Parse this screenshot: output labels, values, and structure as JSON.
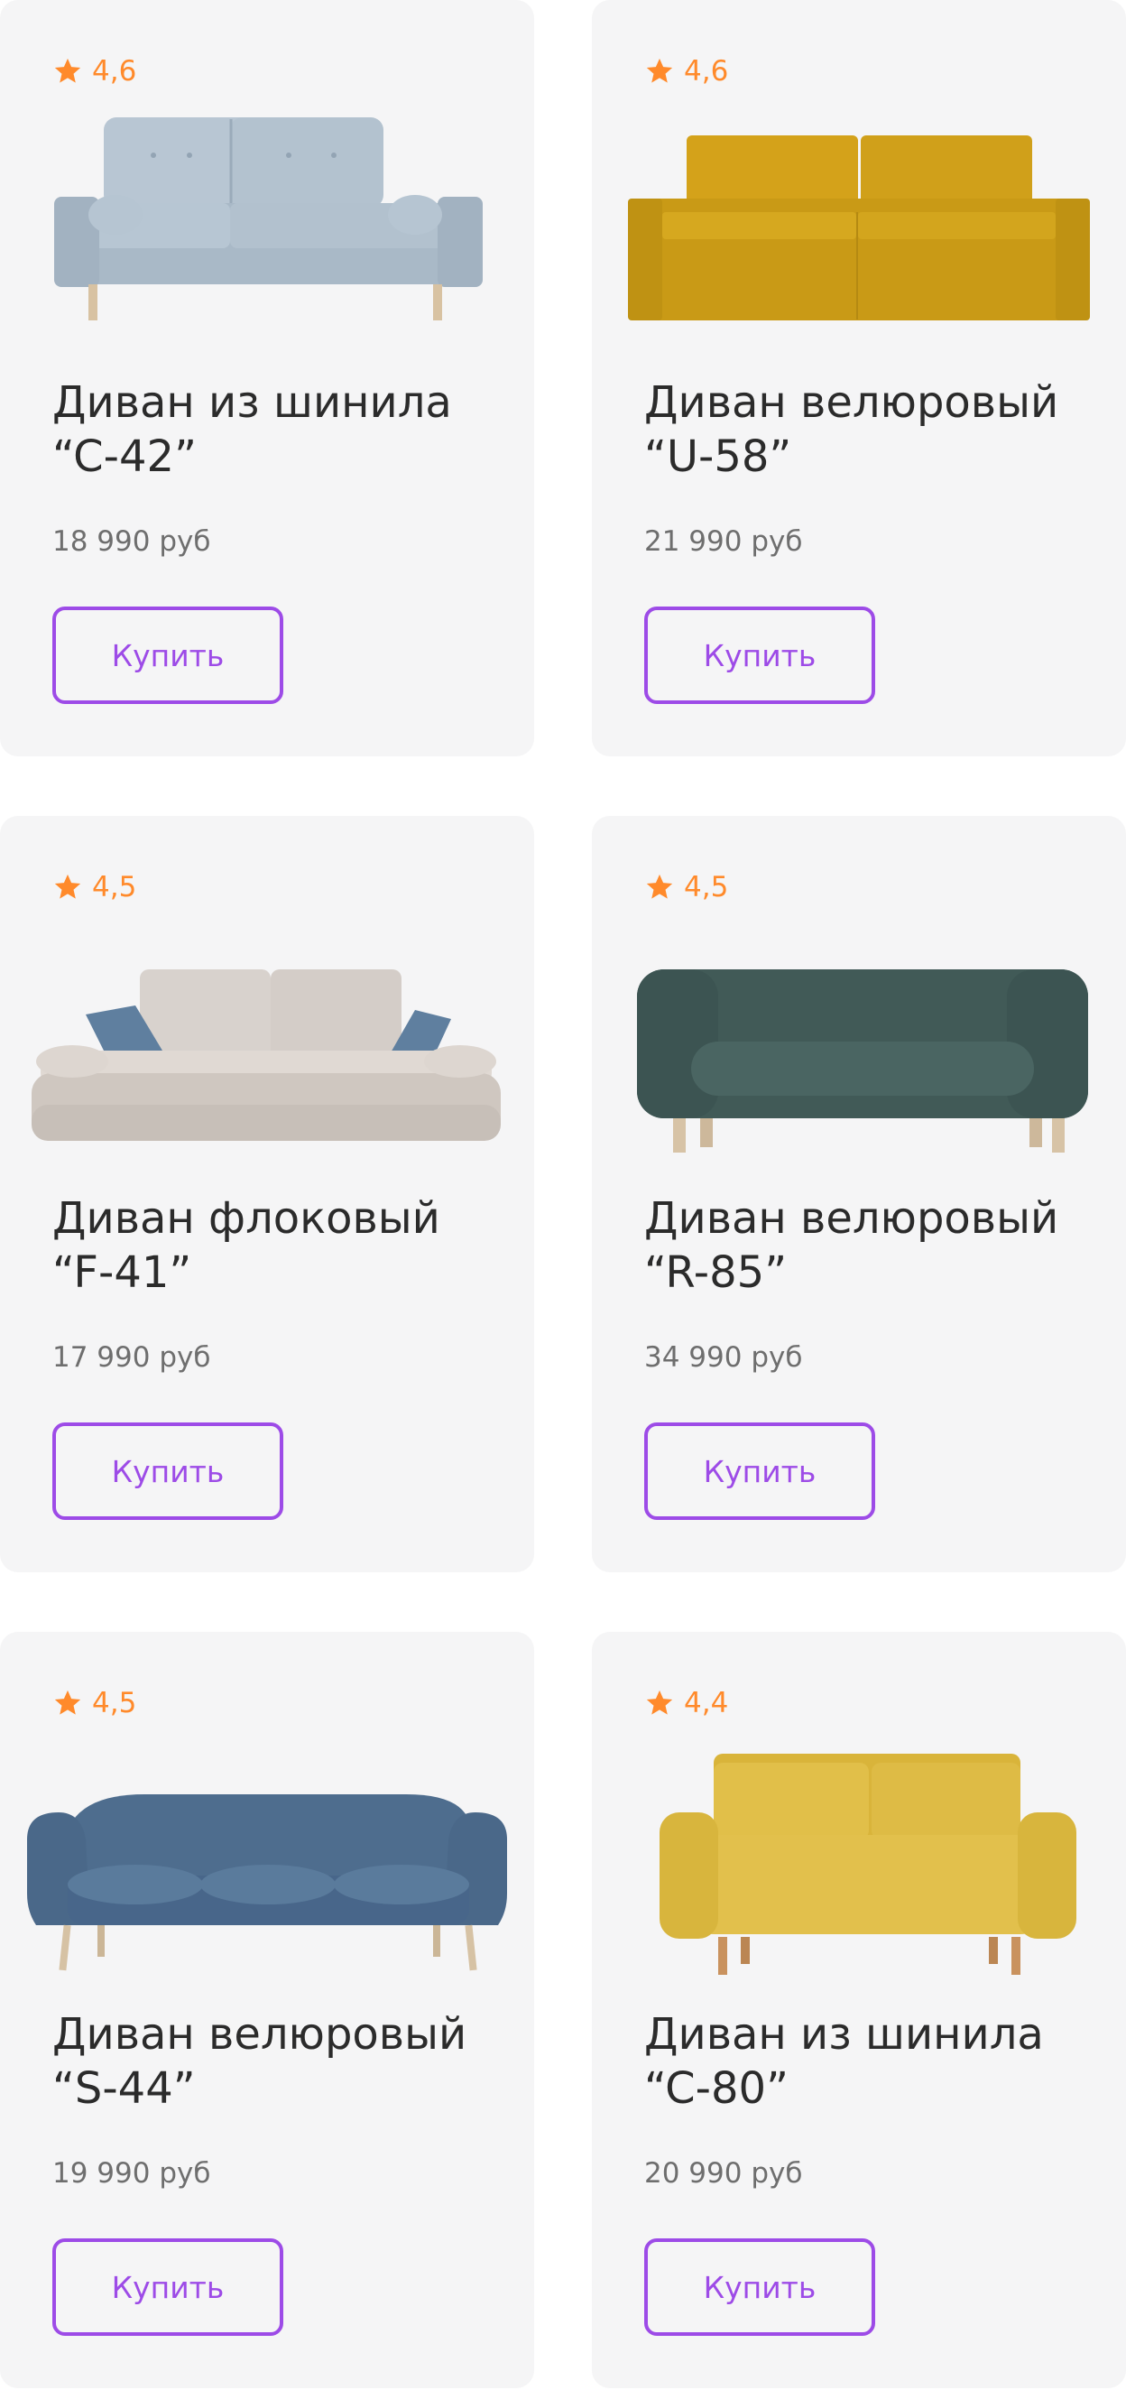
{
  "colors": {
    "card_bg": "#f5f5f6",
    "accent": "#9d4be7",
    "rating": "#ff8a2b",
    "title": "#2b2b2b",
    "price": "#6e6e6e"
  },
  "products": [
    {
      "rating": "4,6",
      "title_line1": "Диван из шинила",
      "title_line2": "“C-42”",
      "price": "18 990 руб",
      "button": "Купить",
      "image": "light-blue-sofa"
    },
    {
      "rating": "4,6",
      "title_line1": "Диван велюровый",
      "title_line2": "“U-58”",
      "price": "21 990 руб",
      "button": "Купить",
      "image": "mustard-sofa"
    },
    {
      "rating": "4,5",
      "title_line1": "Диван флоковый",
      "title_line2": "“F-41”",
      "price": "17 990 руб",
      "button": "Купить",
      "image": "beige-sofa"
    },
    {
      "rating": "4,5",
      "title_line1": "Диван велюровый",
      "title_line2": "“R-85”",
      "price": "34 990 руб",
      "button": "Купить",
      "image": "dark-green-sofa"
    },
    {
      "rating": "4,5",
      "title_line1": "Диван велюровый",
      "title_line2": "“S-44”",
      "price": "19 990 руб",
      "button": "Купить",
      "image": "blue-sofa"
    },
    {
      "rating": "4,4",
      "title_line1": "Диван из шинила",
      "title_line2": "“C-80”",
      "price": "20 990 руб",
      "button": "Купить",
      "image": "yellow-sofa"
    }
  ]
}
